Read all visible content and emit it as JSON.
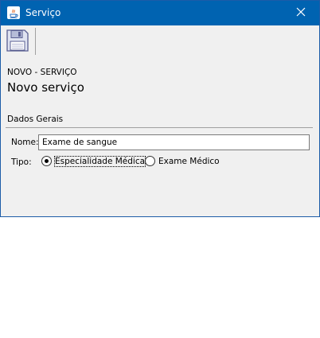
{
  "window": {
    "title": "Serviço",
    "title_icon": "java-icon",
    "close_icon": "close-icon"
  },
  "toolbar": {
    "save_icon": "floppy-disk-icon"
  },
  "header": {
    "subtitle": "NOVO - SERVIÇO",
    "heading": "Novo serviço"
  },
  "section": {
    "label": "Dados Gerais"
  },
  "form": {
    "name_label": "Nome:",
    "name_value": "Exame de sangue",
    "tipo_label": "Tipo:",
    "options": [
      {
        "label": "Especialidade Médica",
        "selected": true
      },
      {
        "label": "Exame Médico",
        "selected": false
      }
    ]
  },
  "colors": {
    "titlebar": "#0063b1",
    "window_bg": "#f0f0f0"
  }
}
